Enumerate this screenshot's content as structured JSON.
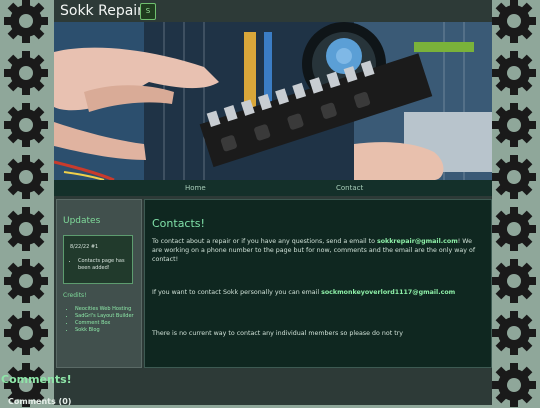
{
  "header": {
    "title": "Sokk Repairs!",
    "logo_text": "S"
  },
  "nav": {
    "items": [
      {
        "label": "Home"
      },
      {
        "label": "Contact"
      }
    ]
  },
  "sidebar": {
    "updates_title": "Updates",
    "update": {
      "date": "8/22/22 #1",
      "items": [
        "Contacts page has been added!"
      ]
    },
    "credits_title": "Credits!",
    "credits": [
      "Neocities Web Hosting",
      "SadGrl's Layout Builder",
      "Comment Box",
      "Sokk Blog"
    ]
  },
  "main": {
    "title": "Contacts!",
    "p1_text": "To contact about a repair or if you have any questions, send a email to",
    "p1_email": "sokkrepair@gmail.com",
    "p1_tail": "! We are working on a phone number to the page but for now, comments and the email are the only way of contact!",
    "p2_text": "If you want to contact Sokk personally you can email",
    "p2_email": "sockmonkeyoverlord1117@gmail.com",
    "p3_text": "There is no current way to contact any individual members so please do not try"
  },
  "comments": {
    "title": "Comments!",
    "label": "Comments",
    "count": "(0)"
  },
  "colors": {
    "background": "#8fa79a",
    "panel": "#2d3a37",
    "accent": "#80e0a8",
    "main_bg": "#0f2720",
    "nav_bg": "#14302a"
  },
  "icons": [
    "gear-icon"
  ]
}
